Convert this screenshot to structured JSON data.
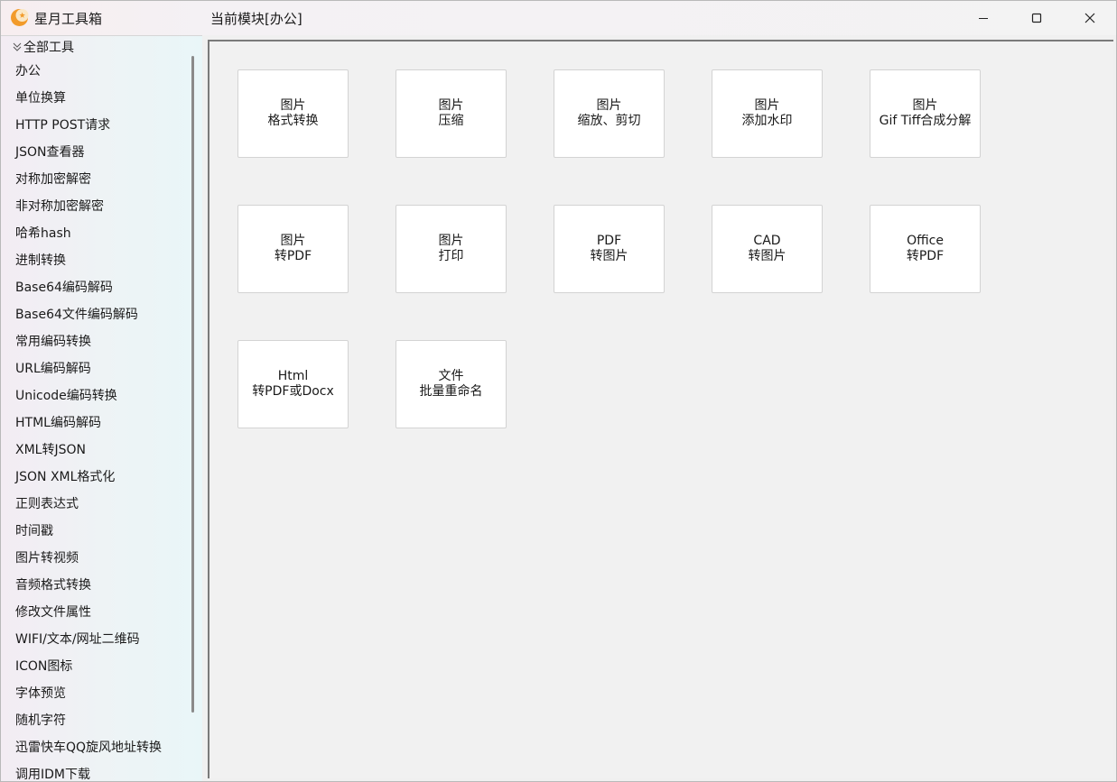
{
  "app": {
    "title": "星月工具箱"
  },
  "header": {
    "module_title": "当前模块[办公]"
  },
  "window_controls": {
    "minimize_icon": "minimize-icon",
    "maximize_icon": "maximize-icon",
    "close_icon": "close-icon"
  },
  "sidebar": {
    "root_label": "全部工具",
    "items": [
      "办公",
      "单位换算",
      "HTTP POST请求",
      "JSON查看器",
      "对称加密解密",
      "非对称加密解密",
      "哈希hash",
      "进制转换",
      "Base64编码解码",
      "Base64文件编码解码",
      "常用编码转换",
      "URL编码解码",
      "Unicode编码转换",
      "HTML编码解码",
      "XML转JSON",
      "JSON XML格式化",
      "正则表达式",
      "时间戳",
      "图片转视频",
      "音频格式转换",
      "修改文件属性",
      "WIFI/文本/网址二维码",
      "ICON图标",
      "字体预览",
      "随机字符",
      "迅雷快车QQ旋风地址转换",
      "调用IDM下载"
    ]
  },
  "tiles": [
    {
      "line1": "图片",
      "line2": "格式转换"
    },
    {
      "line1": "图片",
      "line2": "压缩"
    },
    {
      "line1": "图片",
      "line2": "缩放、剪切"
    },
    {
      "line1": "图片",
      "line2": "添加水印"
    },
    {
      "line1": "图片",
      "line2": "Gif Tiff合成分解"
    },
    {
      "line1": "图片",
      "line2": "转PDF"
    },
    {
      "line1": "图片",
      "line2": "打印"
    },
    {
      "line1": "PDF",
      "line2": "转图片"
    },
    {
      "line1": "CAD",
      "line2": "转图片"
    },
    {
      "line1": "Office",
      "line2": "转PDF"
    },
    {
      "line1": "Html",
      "line2": "转PDF或Docx"
    },
    {
      "line1": "文件",
      "line2": "批量重命名"
    }
  ]
}
